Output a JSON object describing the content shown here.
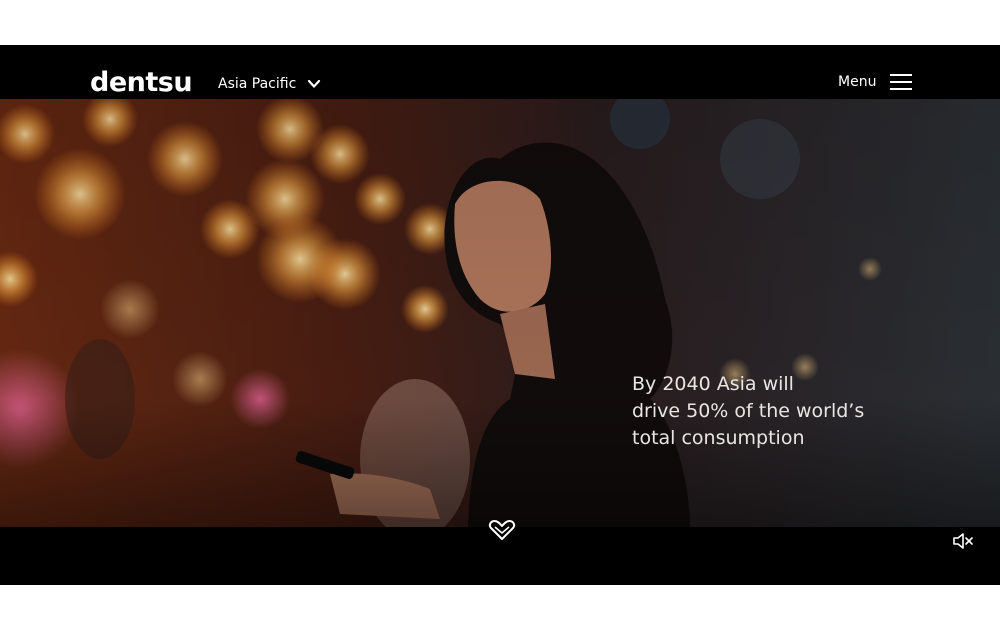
{
  "header": {
    "logo_text": "dentsu",
    "region_label": "Asia Pacific",
    "menu_label": "Menu",
    "icons": {
      "region": "chevron-down-icon",
      "menu": "hamburger-menu-icon"
    }
  },
  "hero": {
    "headline_lines": [
      "By 2040 Asia will",
      "drive 50% of the world’s",
      "total consumption"
    ]
  },
  "controls": {
    "icons": {
      "scroll": "heart-chevron-icon",
      "mute": "speaker-muted-icon"
    }
  },
  "colors": {
    "bar": "#000000",
    "text": "#ffffff",
    "headline": "#e8e6e2",
    "lantern_glow": "#ffb24a"
  }
}
